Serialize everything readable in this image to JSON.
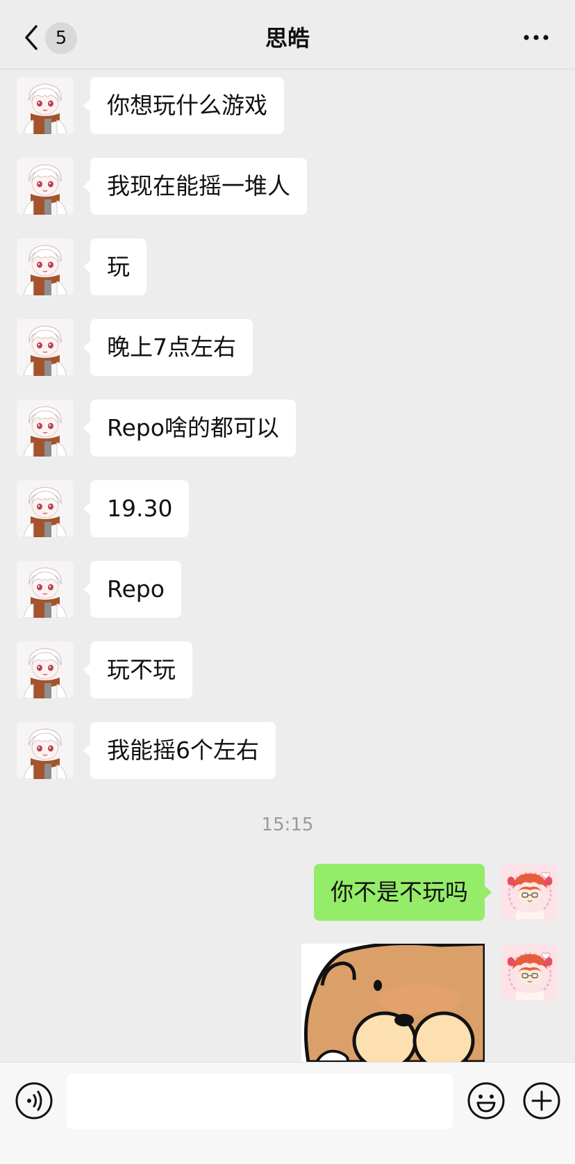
{
  "header": {
    "back_icon": "chevron-left-icon",
    "unread_count": "5",
    "title": "思皓",
    "more_icon": "ellipsis-icon"
  },
  "messages": [
    {
      "side": "left",
      "text": "你想玩什么游戏"
    },
    {
      "side": "left",
      "text": "我现在能摇一堆人"
    },
    {
      "side": "left",
      "text": "玩"
    },
    {
      "side": "left",
      "text": "晚上7点左右"
    },
    {
      "side": "left",
      "text": "Repo啥的都可以"
    },
    {
      "side": "left",
      "text": "19.30"
    },
    {
      "side": "left",
      "text": "Repo"
    },
    {
      "side": "left",
      "text": "玩不玩"
    },
    {
      "side": "left",
      "text": "我能摇6个左右"
    },
    {
      "side": "right",
      "text": "你不是不玩吗"
    },
    {
      "side": "right",
      "type": "sticker",
      "sticker": "bear-sticker"
    }
  ],
  "timestamp": "15:15",
  "bottom_bar": {
    "voice_icon": "voice-icon",
    "input_value": "",
    "mic_icon": "microphone-icon",
    "emoji_icon": "emoji-icon",
    "plus_icon": "plus-icon"
  },
  "colors": {
    "background": "#ededed",
    "incoming_bubble": "#ffffff",
    "outgoing_bubble": "#95ec69"
  }
}
